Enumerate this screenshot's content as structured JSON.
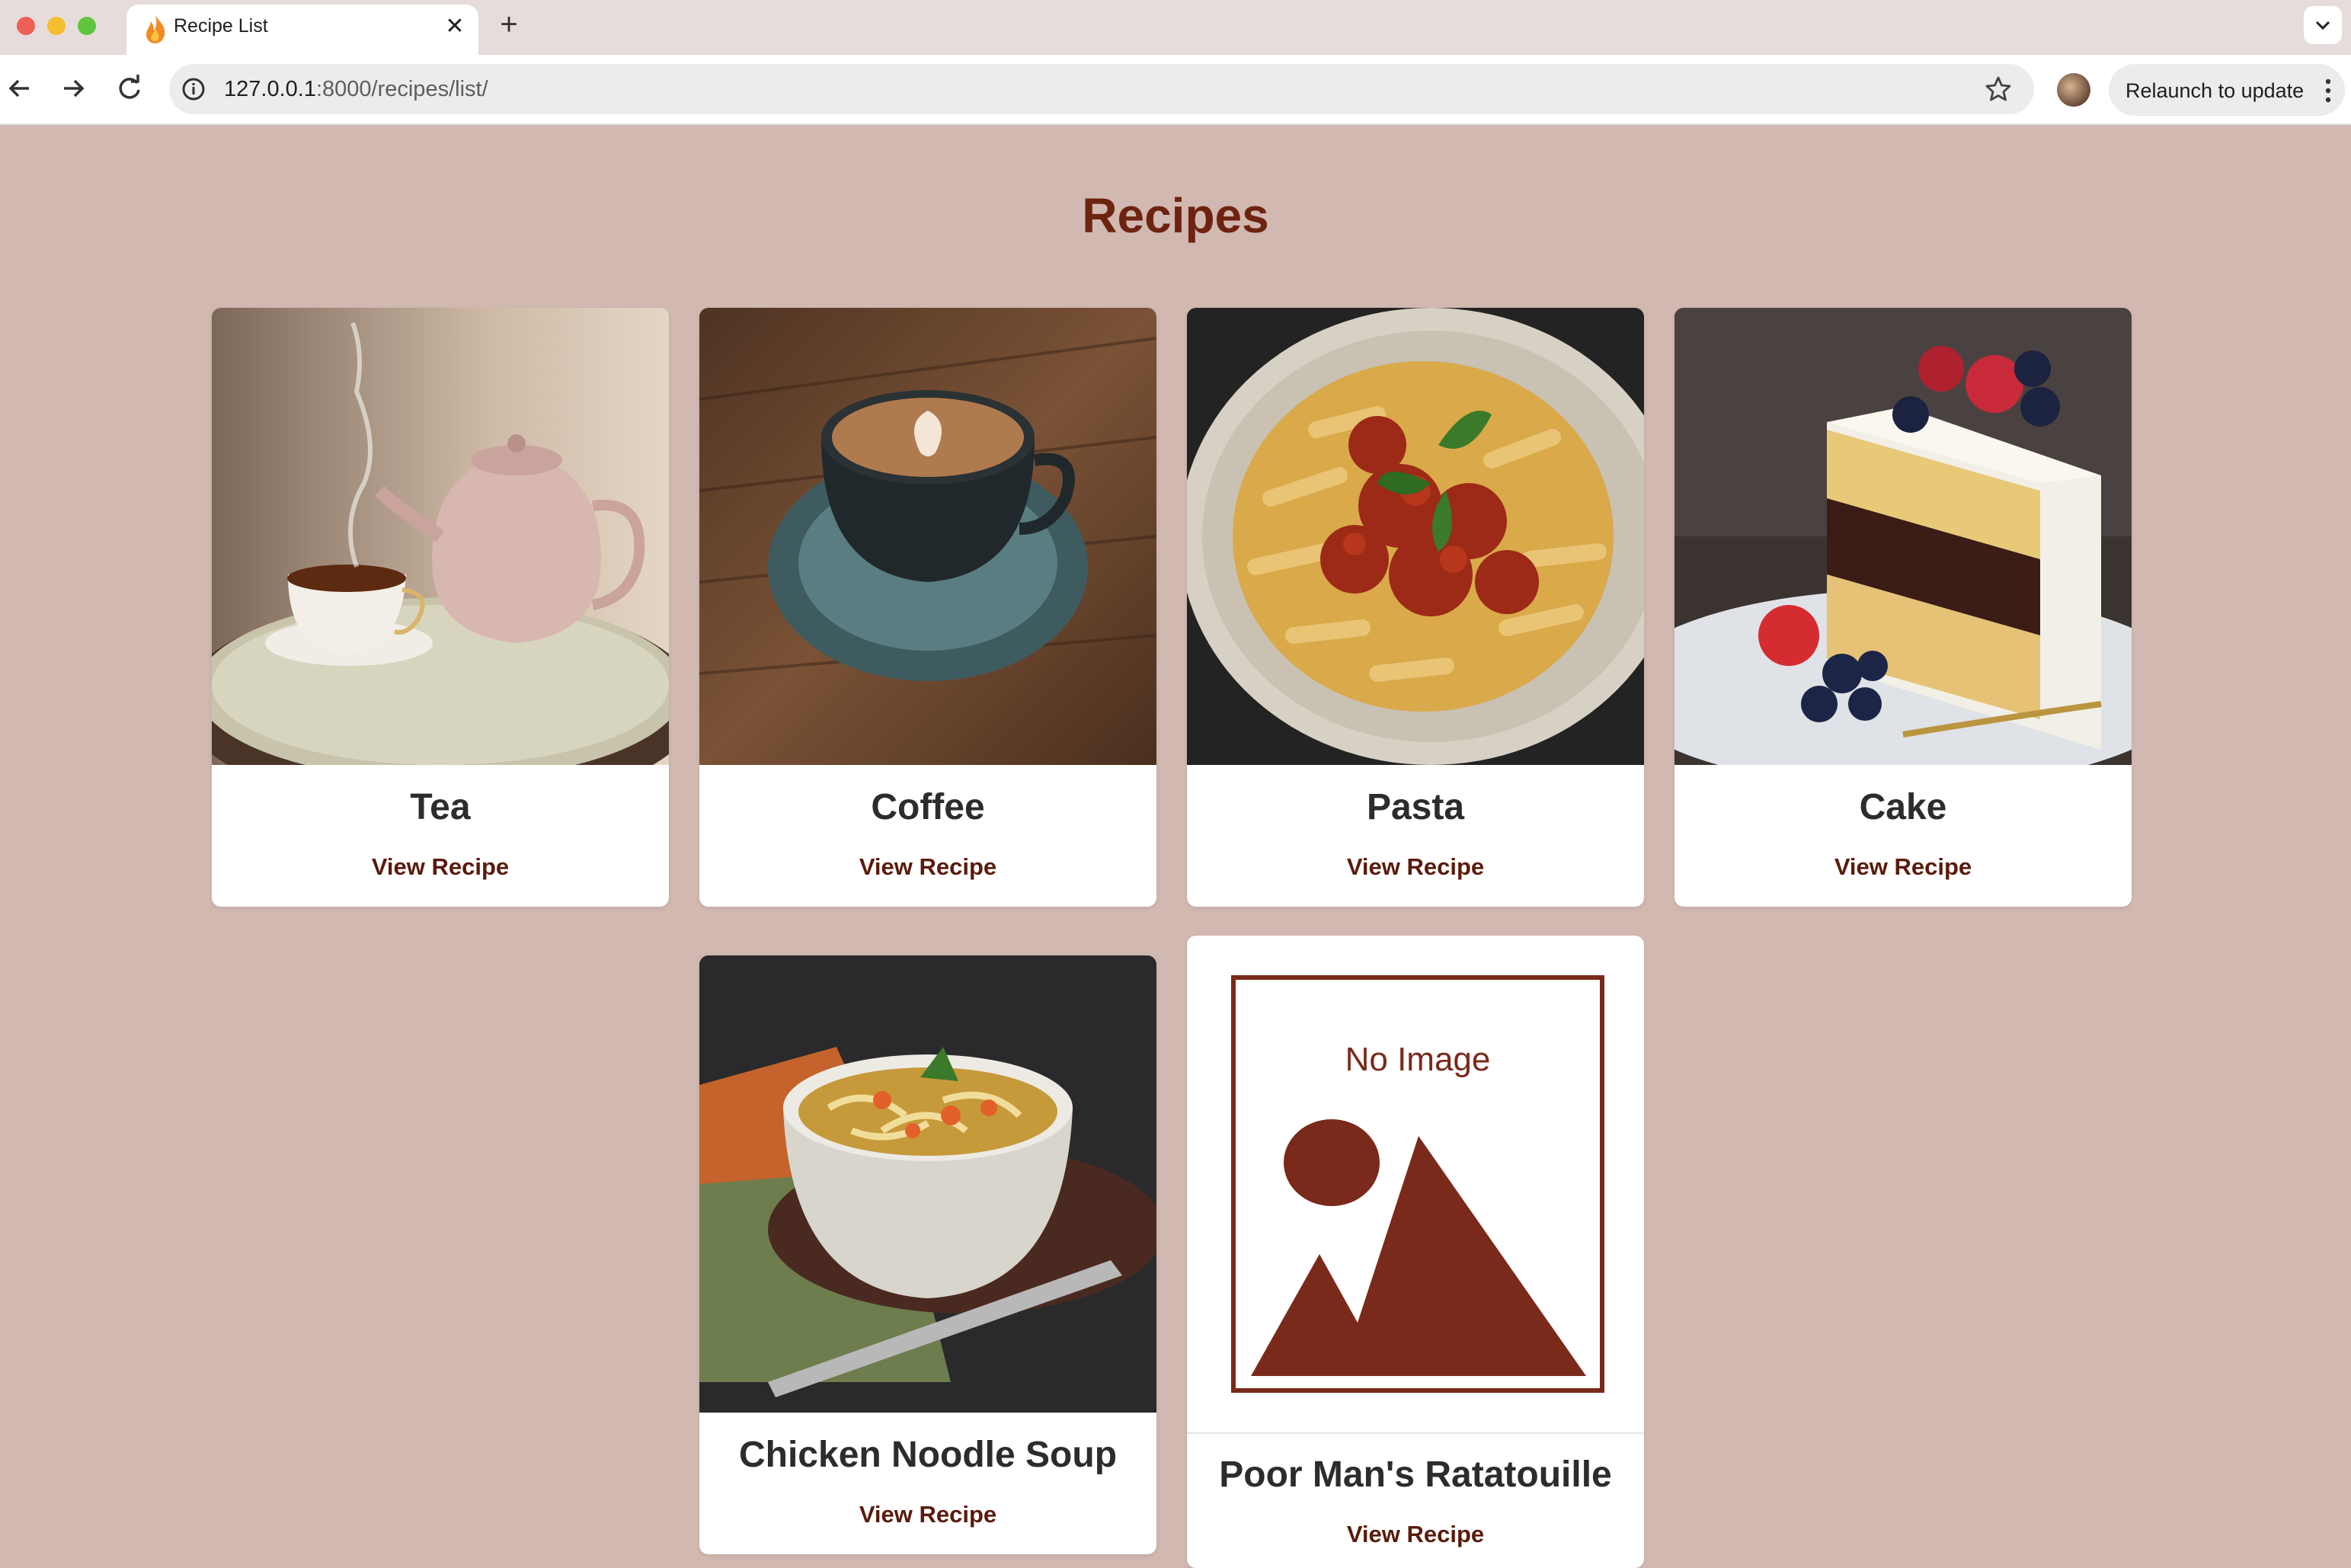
{
  "browser": {
    "tab_title": "Recipe List",
    "url_host": "127.0.0.1",
    "url_rest": ":8000/recipes/list/",
    "relaunch_label": "Relaunch to update",
    "new_tab_symbol": "+",
    "close_symbol": "✕"
  },
  "page": {
    "title": "Recipes"
  },
  "recipes": [
    {
      "name": "Tea",
      "link": "View Recipe",
      "image": "tea-photo"
    },
    {
      "name": "Coffee",
      "link": "View Recipe",
      "image": "coffee-photo"
    },
    {
      "name": "Pasta",
      "link": "View Recipe",
      "image": "pasta-photo"
    },
    {
      "name": "Cake",
      "link": "View Recipe",
      "image": "cake-photo"
    },
    {
      "name": "Chicken Noodle Soup",
      "link": "View Recipe",
      "image": "soup-photo"
    },
    {
      "name": "Poor Man's Ratatouille",
      "link": "View Recipe",
      "image": "no-image-placeholder",
      "placeholder_text": "No Image"
    }
  ],
  "colors": {
    "page_bg": "#d1b8b1",
    "title": "#6e2310",
    "link": "#5a1b0c",
    "placeholder": "#7a2a1a"
  }
}
